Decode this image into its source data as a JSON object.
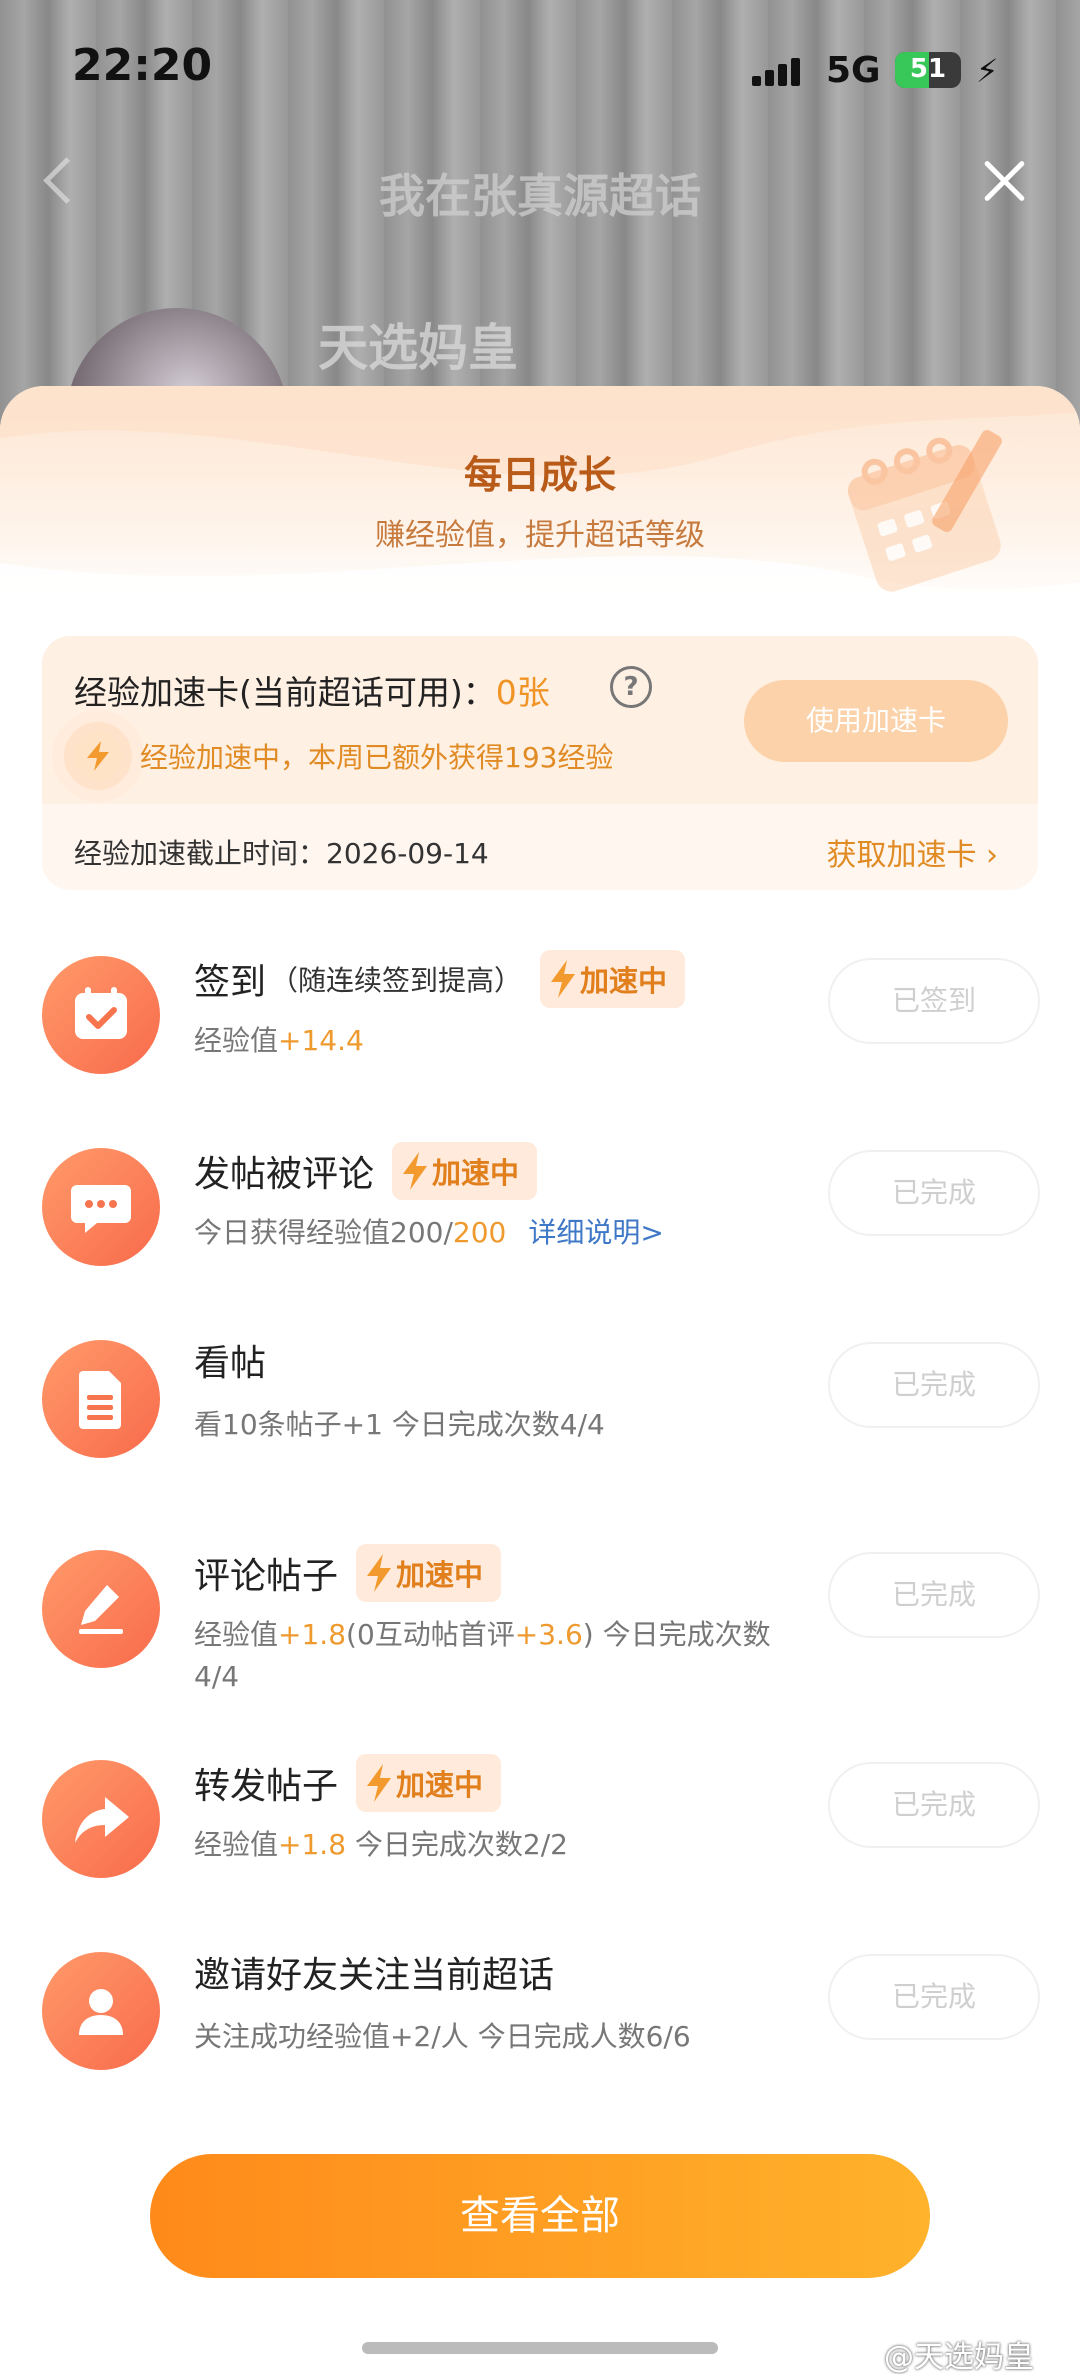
{
  "status": {
    "time": "22:20",
    "network": "5G",
    "battery": "51",
    "battery_level": 0.51
  },
  "nav": {
    "title": "我在张真源超话",
    "username": "天选妈皇"
  },
  "sheet": {
    "title": "每日成长",
    "subtitle": "赚经验值，提升超话等级"
  },
  "booster": {
    "label": "经验加速卡(当前超话可用)：",
    "count": "0张",
    "use_button": "使用加速卡",
    "accelerating_text": "经验加速中，本周已额外获得193经验",
    "deadline": "经验加速截止时间：2026-09-14",
    "get_link": "获取加速卡"
  },
  "badge_text": "加速中",
  "tasks": [
    {
      "title": "签到",
      "note": "（随连续签到提高）",
      "desc_prefix": "经验值",
      "desc_value": "+14.4",
      "button": "已签到",
      "icon": "calendar-icon"
    },
    {
      "title": "发帖被评论",
      "desc_prefix": "今日获得经验值200/",
      "desc_value": "200",
      "link": "详细说明>",
      "button": "已完成",
      "icon": "chat-bubble-icon"
    },
    {
      "title": "看帖",
      "desc": "看10条帖子+1   今日完成次数4/4",
      "button": "已完成",
      "icon": "document-icon"
    },
    {
      "title": "评论帖子",
      "desc_a": "经验值",
      "desc_v1": "+1.8",
      "desc_b": "(0互动帖首评",
      "desc_v2": "+3.6",
      "desc_c": ")   今日完成次数4/4",
      "button": "已完成",
      "icon": "edit-pen-icon"
    },
    {
      "title": "转发帖子",
      "desc_prefix": "经验值",
      "desc_value": "+1.8",
      "desc_suffix": "   今日完成次数2/2",
      "button": "已完成",
      "icon": "share-arrow-icon"
    },
    {
      "title": "邀请好友关注当前超话",
      "desc": "关注成功经验值+2/人   今日完成人数6/6",
      "button": "已完成",
      "icon": "user-icon"
    }
  ],
  "footer": {
    "view_all": "查看全部",
    "watermark": "@天选妈皇"
  },
  "colors": {
    "accent": "#ff8a1a",
    "badge_text": "#e07f1c",
    "icon_gradient": "#f96b4c"
  }
}
